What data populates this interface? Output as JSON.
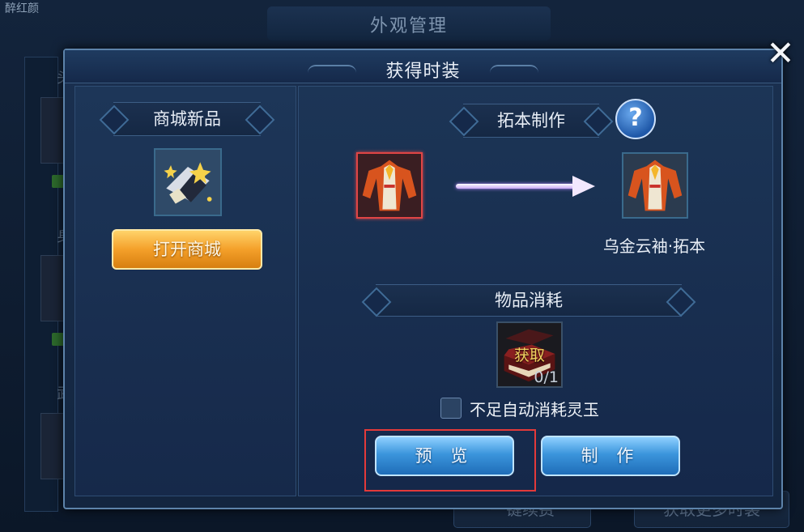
{
  "background": {
    "title": "外观管理",
    "top_left_label": "醉红颜",
    "buttons": [
      "一键续费",
      "获取更多时装"
    ]
  },
  "dialog": {
    "title": "获得时装",
    "close_icon": "close-icon"
  },
  "left_panel": {
    "header": "商城新品",
    "item_icon": "mall-item-icon",
    "open_button": "打开商城"
  },
  "right_panel": {
    "header": "拓本制作",
    "help_icon": "question-icon",
    "result_name": "乌金云袖·拓本",
    "consume_header": "物品消耗",
    "consume_item_label": "获取",
    "consume_count": "0/1",
    "auto_consume_label": "不足自动消耗灵玉",
    "auto_consume_checked": false,
    "preview_button": "预 览",
    "make_button": "制 作"
  },
  "colors": {
    "highlight": "#e33a3a",
    "gold_button": "#f4a02a",
    "blue_button": "#3b95dc"
  }
}
